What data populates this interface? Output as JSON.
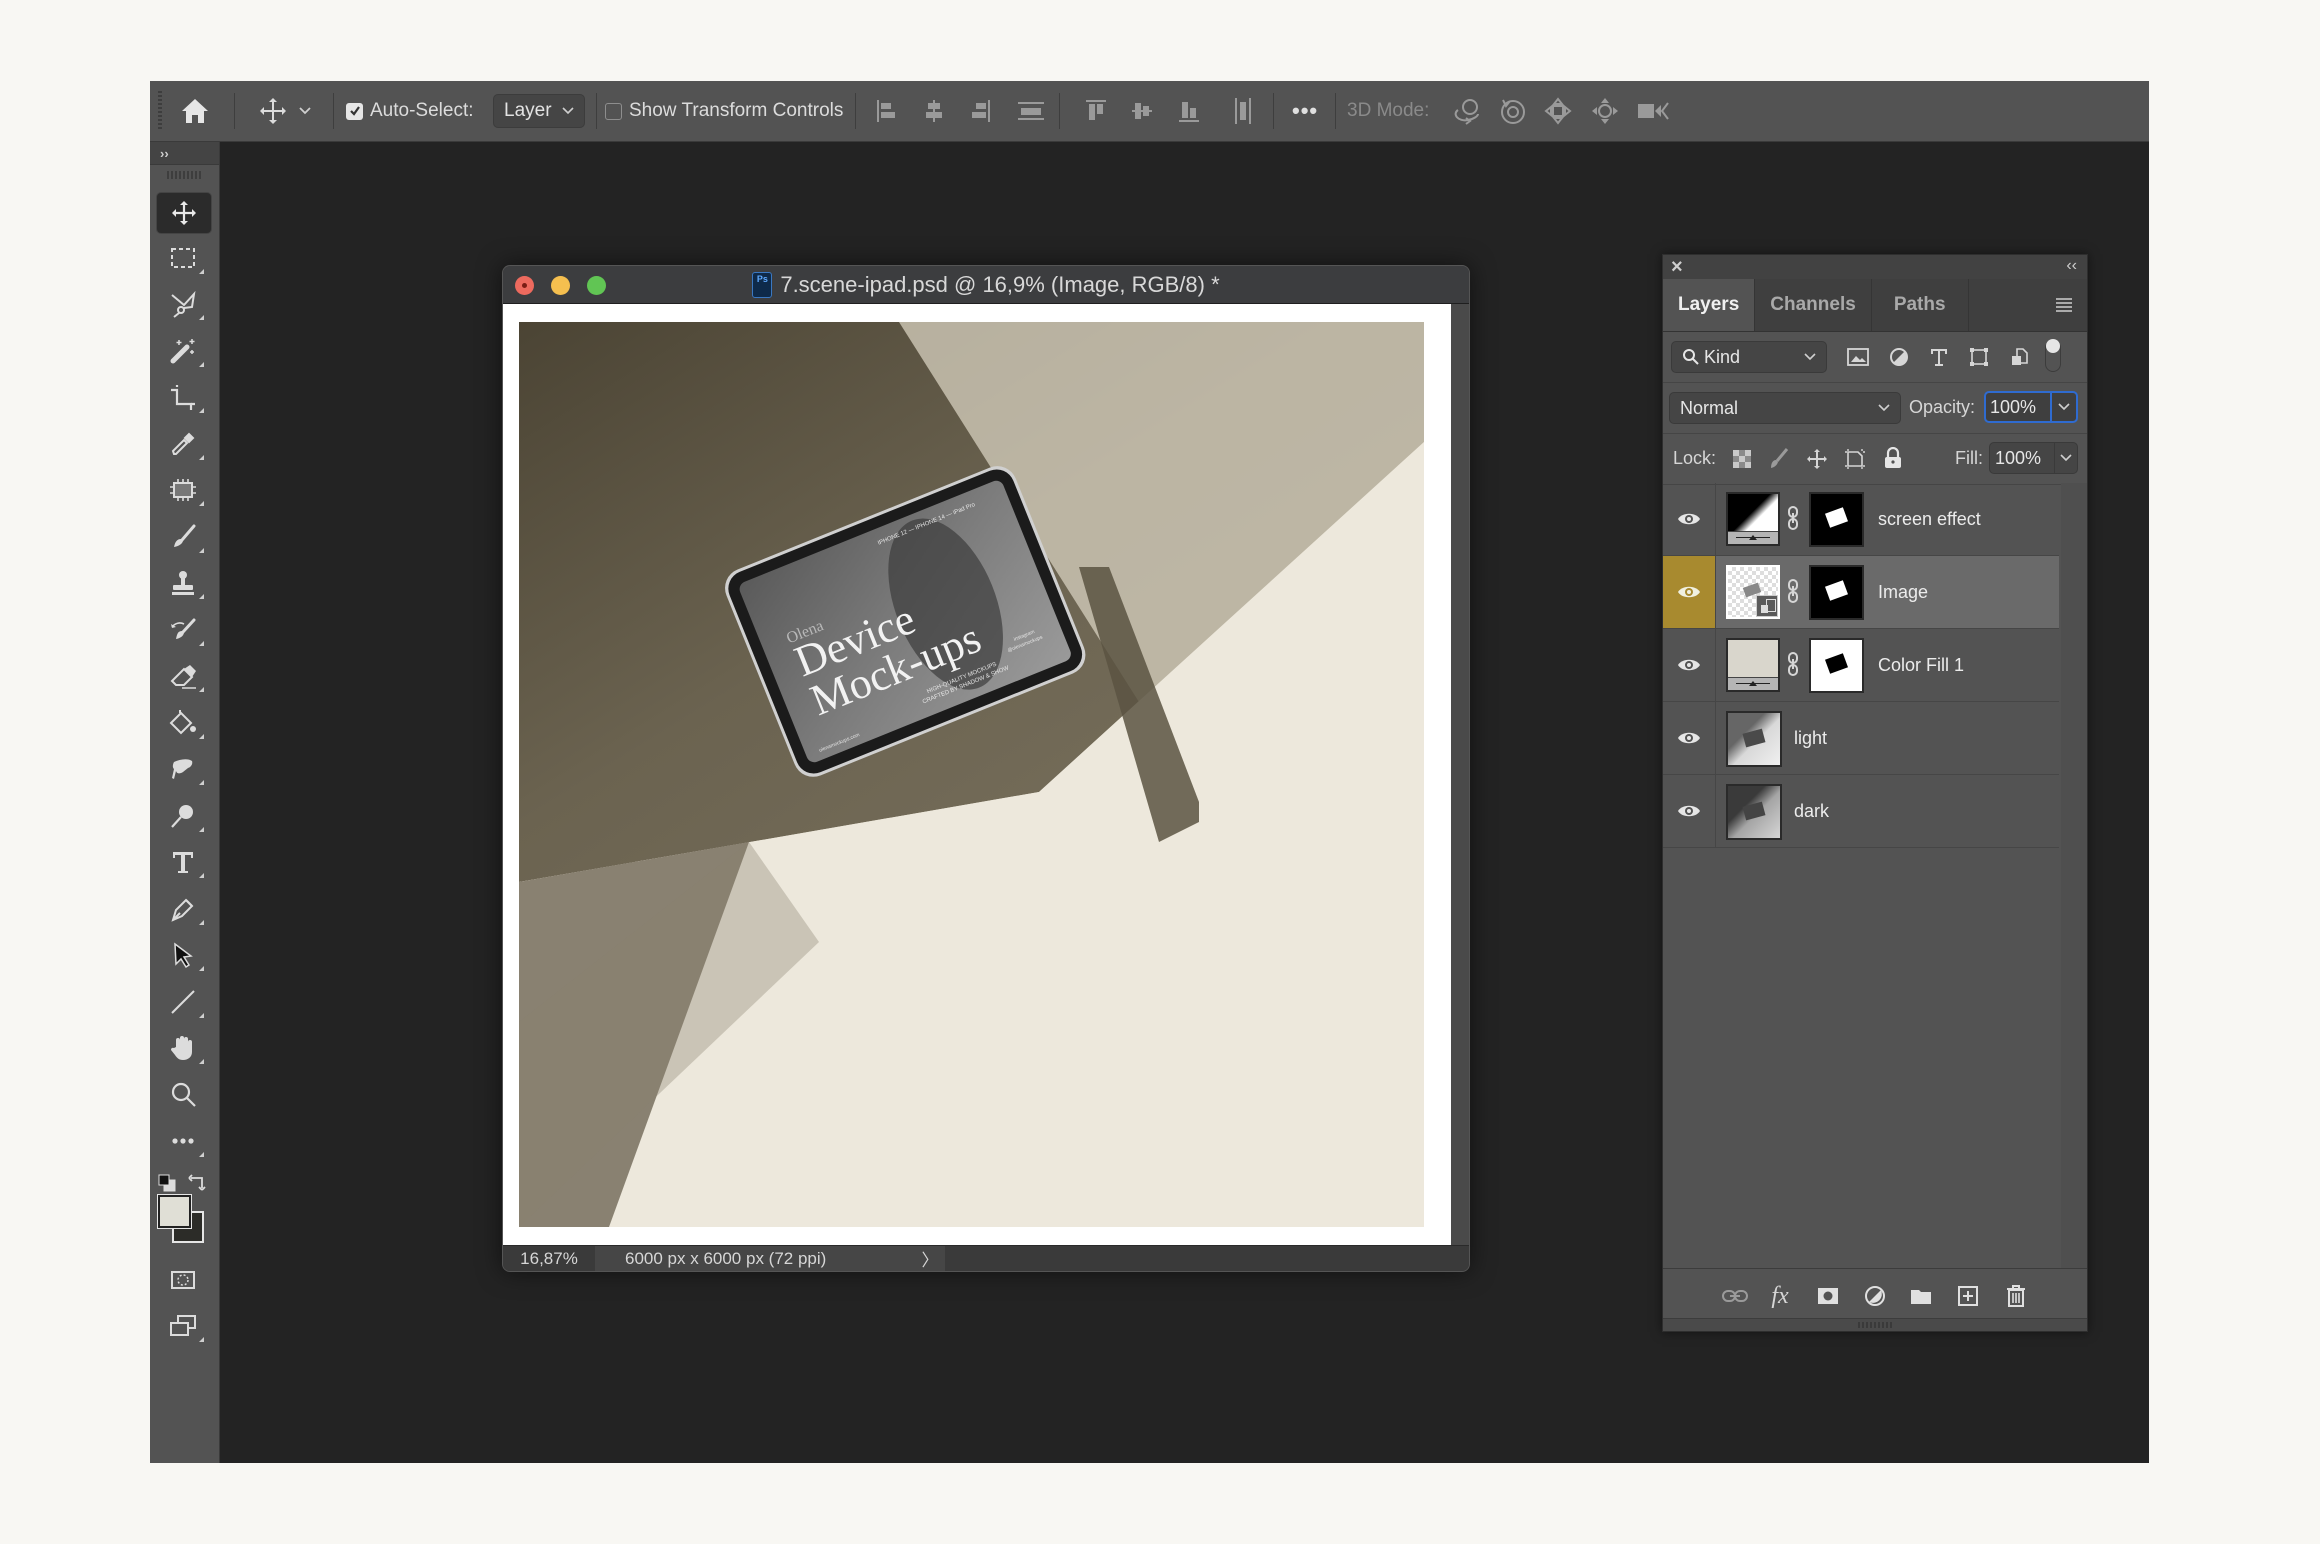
{
  "option_bar": {
    "home_icon": "home-icon",
    "move_tool_icon": "move-icon",
    "auto_select_checked": true,
    "auto_select_label": "Auto-Select:",
    "auto_select_value": "Layer",
    "show_transform_checked": false,
    "show_transform_label": "Show Transform Controls",
    "align_icons": [
      "align-left-edges",
      "align-horizontal-centers",
      "align-right-edges",
      "distribute-vertical",
      "align-top-edges",
      "align-vertical-centers",
      "align-bottom-edges",
      "distribute-horizontal"
    ],
    "more_label": "•••",
    "mode_3d_label": "3D Mode:",
    "mode_3d_icons": [
      "orbit-3d",
      "roll-3d",
      "pan-3d",
      "slide-3d",
      "scale-3d"
    ]
  },
  "tools": {
    "expand_label": "››",
    "items": [
      {
        "name": "move",
        "active": true
      },
      {
        "name": "rectangular-marquee"
      },
      {
        "name": "polygonal-lasso"
      },
      {
        "name": "magic-wand"
      },
      {
        "name": "crop"
      },
      {
        "name": "eyedropper"
      },
      {
        "name": "frame"
      },
      {
        "name": "brush"
      },
      {
        "name": "clone-stamp"
      },
      {
        "name": "history-brush"
      },
      {
        "name": "eraser"
      },
      {
        "name": "paint-bucket"
      },
      {
        "name": "smudge"
      },
      {
        "name": "dodge"
      },
      {
        "name": "type"
      },
      {
        "name": "pen"
      },
      {
        "name": "path-selection"
      },
      {
        "name": "line"
      },
      {
        "name": "hand"
      },
      {
        "name": "zoom"
      },
      {
        "name": "edit-toolbar"
      }
    ],
    "foreground_color": "#e0dfd6",
    "background_color": "#2c2c28"
  },
  "document": {
    "title": "7.scene-ipad.psd @ 16,9% (Image, RGB/8) *",
    "ps_badge": "Ps",
    "zoom": "16,87%",
    "doc_info": "6000 px x 6000 px (72 ppi)",
    "status_arrow": "〉",
    "artwork": {
      "small_title": "Olena",
      "headline_1": "Device",
      "headline_2": "Mock-ups",
      "tagline_1": "HIGH-QUALITY MOCKUPS",
      "tagline_2": "CRAFTED BY SHADOW & SHOW",
      "top_right": "IPHONE 12 — IPHONE 14 — iPad Pro",
      "bottom_right_1": "instagram",
      "bottom_right_2": "@olenamockups",
      "bottom_left": "olenamockups.com"
    }
  },
  "layers_panel": {
    "close_label": "×",
    "collapse_label": "‹‹",
    "tabs": [
      {
        "label": "Layers",
        "active": true
      },
      {
        "label": "Channels",
        "active": false
      },
      {
        "label": "Paths",
        "active": false
      }
    ],
    "filter_kind": "Kind",
    "blend_mode": "Normal",
    "opacity_label": "Opacity:",
    "opacity_value": "100%",
    "lock_label": "Lock:",
    "fill_label": "Fill:",
    "fill_value": "100%",
    "layers": [
      {
        "name": "screen effect",
        "visible": true,
        "selected": false,
        "type": "adjustment",
        "has_mask": true
      },
      {
        "name": "Image",
        "visible": true,
        "selected": true,
        "type": "smart-object",
        "has_mask": true
      },
      {
        "name": "Color Fill 1",
        "visible": true,
        "selected": false,
        "type": "fill",
        "has_mask": true
      },
      {
        "name": "light",
        "visible": true,
        "selected": false,
        "type": "pixel",
        "has_mask": false
      },
      {
        "name": "dark",
        "visible": true,
        "selected": false,
        "type": "pixel",
        "has_mask": false
      }
    ],
    "selection_color": "#a88a2f",
    "footer_icons": [
      "link-layers",
      "fx",
      "add-mask",
      "new-adjustment",
      "new-group",
      "new-layer",
      "delete-layer"
    ],
    "footer_fx_label": "fx"
  }
}
